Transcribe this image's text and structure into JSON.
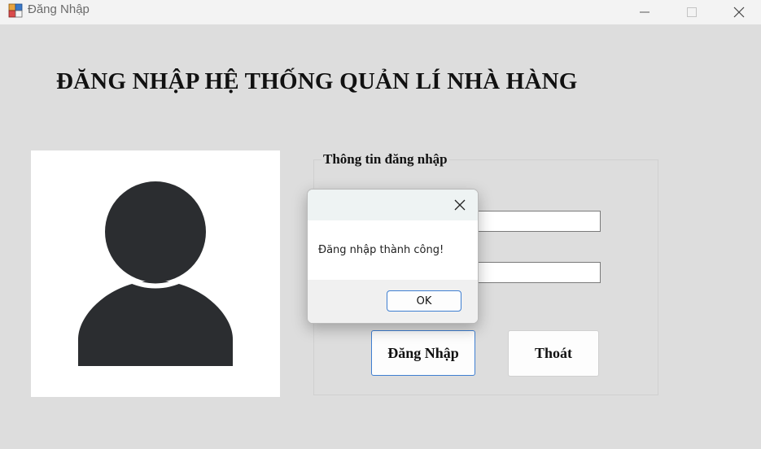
{
  "window": {
    "title": "Đăng Nhập",
    "icon": "winforms-app-icon",
    "controls": {
      "minimize": "minimize-icon",
      "maximize": "maximize-icon",
      "close": "close-icon"
    }
  },
  "heading": "ĐĂNG NHẬP HỆ THỐNG QUẢN LÍ NHÀ HÀNG",
  "avatar": {
    "icon": "user-avatar-icon",
    "color": "#2b2d30"
  },
  "login_group": {
    "label": "Thông tin đăng nhập",
    "username_value": "",
    "password_value": "",
    "login_button": "Đăng Nhập",
    "exit_button": "Thoát"
  },
  "message_box": {
    "message": "Đăng nhập thành công!",
    "ok_button": "OK",
    "close_icon": "close-icon"
  },
  "colors": {
    "accent": "#3f7fd1",
    "background": "#dddddd"
  }
}
